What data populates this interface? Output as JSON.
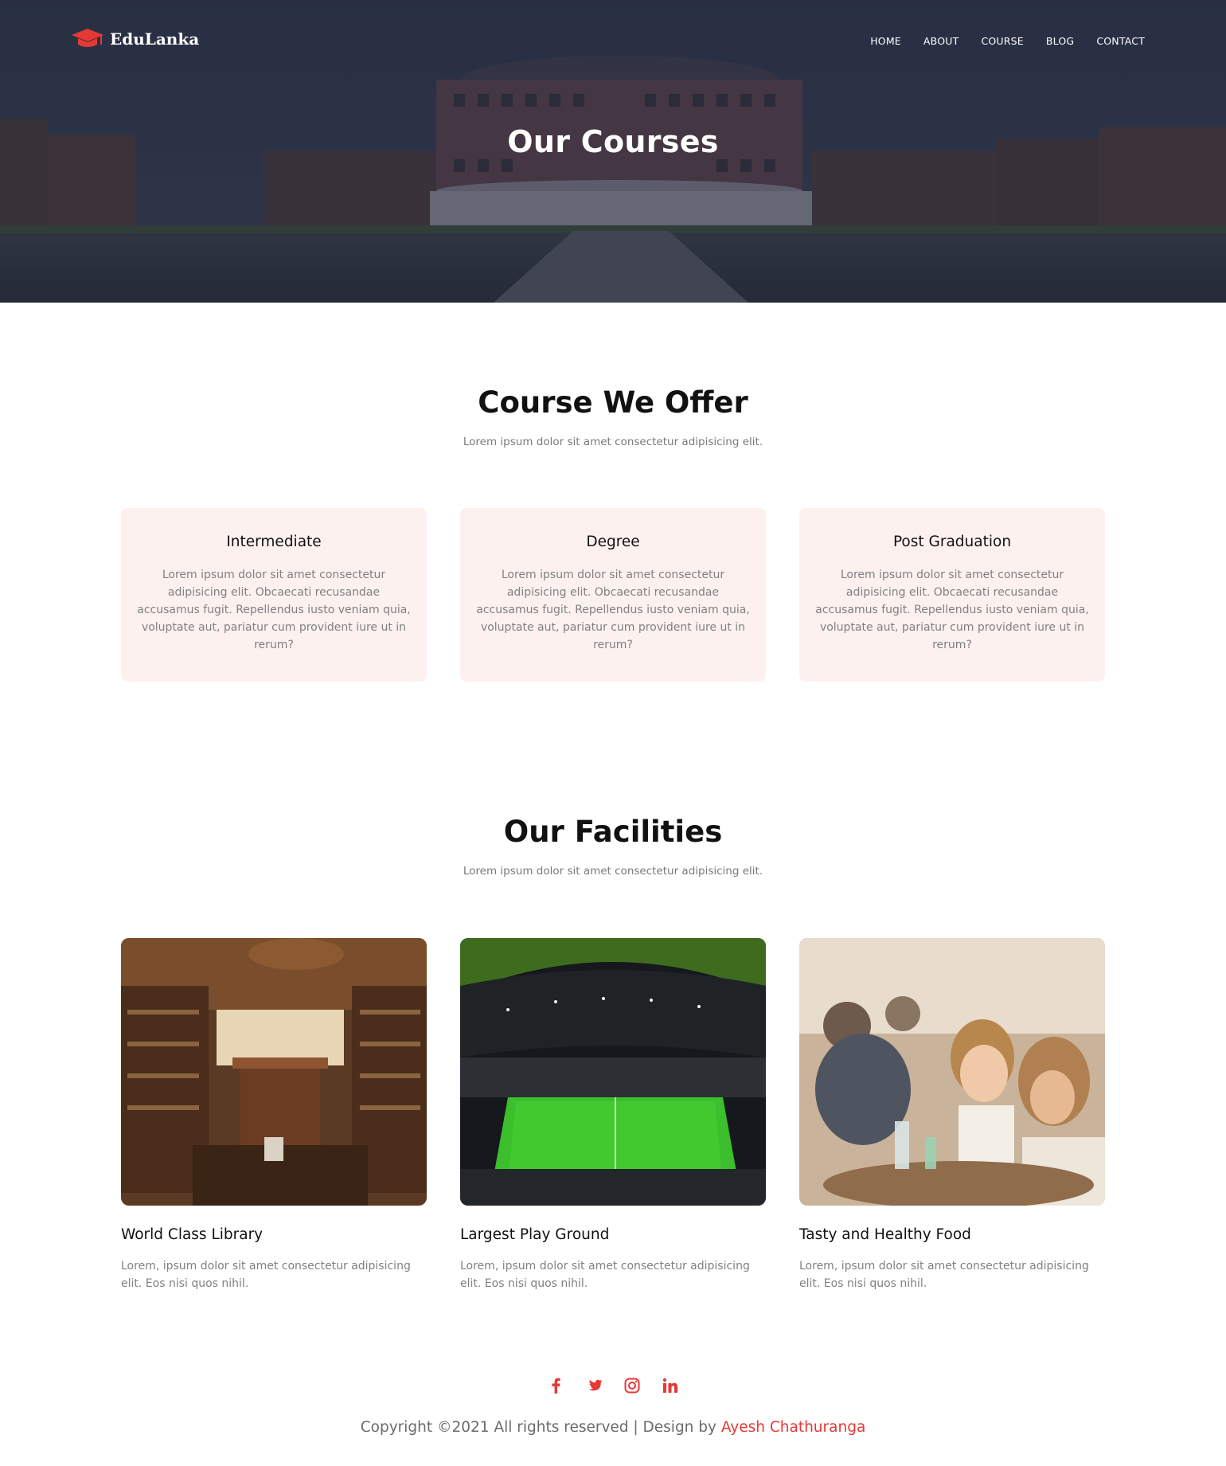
{
  "brand": {
    "name": "EduLanka",
    "logo_icon": "graduation-cap-icon",
    "accent": "#e53935"
  },
  "nav": {
    "items": [
      "HOME",
      "ABOUT",
      "COURSE",
      "BLOG",
      "CONTACT"
    ]
  },
  "hero": {
    "title": "Our Courses",
    "image": "university-building-photo"
  },
  "courses": {
    "title": "Course We Offer",
    "subtitle": "Lorem ipsum dolor sit amet consectetur adipisicing elit.",
    "cards": [
      {
        "title": "Intermediate",
        "text": "Lorem ipsum dolor sit amet consectetur adipisicing elit. Obcaecati recusandae accusamus fugit. Repellendus iusto veniam quia, voluptate aut, pariatur cum provident iure ut in rerum?"
      },
      {
        "title": "Degree",
        "text": "Lorem ipsum dolor sit amet consectetur adipisicing elit. Obcaecati recusandae accusamus fugit. Repellendus iusto veniam quia, voluptate aut, pariatur cum provident iure ut in rerum?"
      },
      {
        "title": "Post Graduation",
        "text": "Lorem ipsum dolor sit amet consectetur adipisicing elit. Obcaecati recusandae accusamus fugit. Repellendus iusto veniam quia, voluptate aut, pariatur cum provident iure ut in rerum?"
      }
    ]
  },
  "facilities": {
    "title": "Our Facilities",
    "subtitle": "Lorem ipsum dolor sit amet consectetur adipisicing elit.",
    "cards": [
      {
        "title": "World Class Library",
        "text": "Lorem, ipsum dolor sit amet consectetur adipisicing elit. Eos nisi quos nihil.",
        "image": "library-photo"
      },
      {
        "title": "Largest Play Ground",
        "text": "Lorem, ipsum dolor sit amet consectetur adipisicing elit. Eos nisi quos nihil.",
        "image": "stadium-photo"
      },
      {
        "title": "Tasty and Healthy Food",
        "text": "Lorem, ipsum dolor sit amet consectetur adipisicing elit. Eos nisi quos nihil.",
        "image": "dining-photo"
      }
    ]
  },
  "footer": {
    "social": [
      {
        "name": "facebook-icon",
        "glyph": "f"
      },
      {
        "name": "twitter-icon",
        "glyph": ""
      },
      {
        "name": "instagram-icon",
        "glyph": ""
      },
      {
        "name": "linkedin-icon",
        "glyph": "in"
      }
    ],
    "copyright": "Copyright ©2021 All rights reserved | Design by",
    "author": "Ayesh Chathuranga"
  }
}
